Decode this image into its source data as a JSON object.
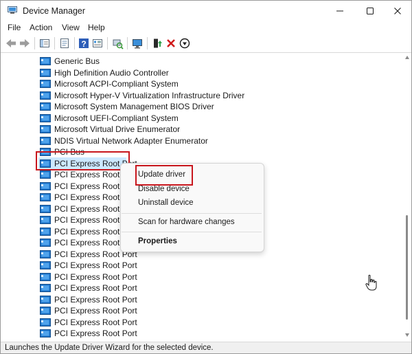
{
  "window": {
    "title": "Device Manager",
    "controls": {
      "minimize": "minimize-icon",
      "maximize": "maximize-icon",
      "close": "close-icon"
    }
  },
  "menu": [
    "File",
    "Action",
    "View",
    "Help"
  ],
  "toolbar": {
    "buttons": [
      "back-arrow-icon",
      "forward-arrow-icon",
      "show-hide-tree-icon",
      "properties-sheet-icon",
      "help-icon",
      "device-view-icon",
      "scan-hardware-icon",
      "monitor-icon",
      "update-driver-icon",
      "uninstall-x-icon",
      "disable-device-icon"
    ]
  },
  "tree": {
    "items": [
      {
        "label": "Generic Bus"
      },
      {
        "label": "High Definition Audio Controller"
      },
      {
        "label": "Microsoft ACPI-Compliant System"
      },
      {
        "label": "Microsoft Hyper-V Virtualization Infrastructure Driver"
      },
      {
        "label": "Microsoft System Management BIOS Driver"
      },
      {
        "label": "Microsoft UEFI-Compliant System"
      },
      {
        "label": "Microsoft Virtual Drive Enumerator"
      },
      {
        "label": "NDIS Virtual Network Adapter Enumerator"
      },
      {
        "label": "PCI Bus"
      },
      {
        "label": "PCI Express Root Port",
        "selected": true
      },
      {
        "label": "PCI Express Root Port"
      },
      {
        "label": "PCI Express Root Port"
      },
      {
        "label": "PCI Express Root Port"
      },
      {
        "label": "PCI Express Root Port"
      },
      {
        "label": "PCI Express Root Port"
      },
      {
        "label": "PCI Express Root Port"
      },
      {
        "label": "PCI Express Root Port"
      },
      {
        "label": "PCI Express Root Port"
      },
      {
        "label": "PCI Express Root Port"
      },
      {
        "label": "PCI Express Root Port"
      },
      {
        "label": "PCI Express Root Port"
      },
      {
        "label": "PCI Express Root Port"
      },
      {
        "label": "PCI Express Root Port"
      },
      {
        "label": "PCI Express Root Port"
      },
      {
        "label": "PCI Express Root Port"
      }
    ]
  },
  "context_menu": {
    "items": [
      "Update driver",
      "Disable device",
      "Uninstall device",
      "Scan for hardware changes",
      "Properties"
    ]
  },
  "status_bar": {
    "text": "Launches the Update Driver Wizard for the selected device."
  },
  "colors": {
    "highlight_box": "#c8161d",
    "selection": "#cce8ff",
    "device_icon_blue": "#1e73c8"
  }
}
